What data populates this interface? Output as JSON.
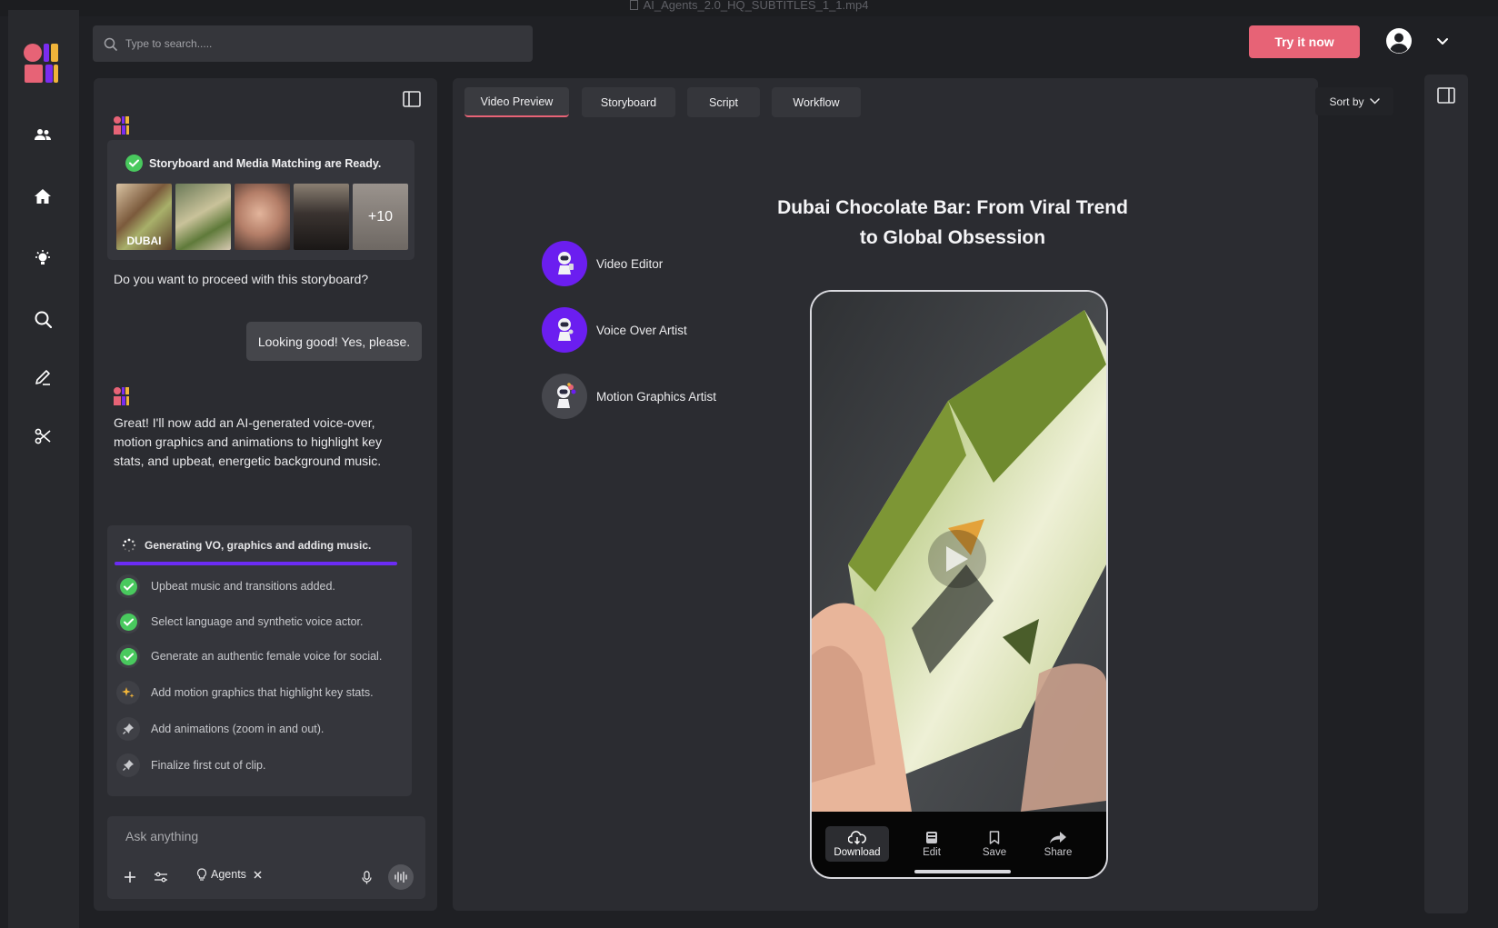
{
  "window": {
    "title": "AI_Agents_2.0_HQ_SUBTITLES_1_1.mp4"
  },
  "header": {
    "search_placeholder": "Type to search.....",
    "try_button": "Try it now"
  },
  "colors": {
    "accent": "#e76376",
    "progress": "#6b2cf5",
    "success": "#49c95e",
    "agent_purple": "#6b1ef0"
  },
  "rail": {
    "icons": [
      "people-icon",
      "home-icon",
      "lightbulb-icon",
      "search-icon",
      "edit-icon",
      "scissors-icon"
    ]
  },
  "chat": {
    "ready_title": "Storyboard and Media Matching are Ready.",
    "thumb_caption": "DUBAI",
    "more_count": "+10",
    "question": "Do you want to proceed with this storyboard?",
    "user_reply": "Looking good! Yes, please.",
    "bot_reply": "Great! I'll now add an AI-generated voice-over, motion graphics and animations to highlight key stats, and upbeat, energetic background music.",
    "generating_title": "Generating VO, graphics and adding music.",
    "steps": [
      {
        "label": "Upbeat music and transitions added.",
        "status": "done"
      },
      {
        "label": "Select language and synthetic voice actor.",
        "status": "done"
      },
      {
        "label": "Generate an authentic female voice for social.",
        "status": "done"
      },
      {
        "label": "Add motion graphics that highlight key stats.",
        "status": "in-progress"
      },
      {
        "label": "Add animations (zoom in and out).",
        "status": "pending"
      },
      {
        "label": "Finalize first cut of clip.",
        "status": "pending"
      }
    ],
    "composer_placeholder": "Ask anything",
    "agents_chip": "Agents"
  },
  "main": {
    "tabs": [
      {
        "label": "Video Preview",
        "active": true
      },
      {
        "label": "Storyboard",
        "active": false
      },
      {
        "label": "Script",
        "active": false
      },
      {
        "label": "Workflow",
        "active": false
      }
    ],
    "sort_label": "Sort by",
    "video_title_line1": "Dubai Chocolate Bar: From Viral Trend",
    "video_title_line2": "to Global Obsession",
    "agents": [
      {
        "label": "Video Editor"
      },
      {
        "label": "Voice Over Artist"
      },
      {
        "label": "Motion Graphics Artist"
      }
    ],
    "phone_actions": [
      {
        "label": "Download",
        "icon": "cloud-download-icon",
        "active": true
      },
      {
        "label": "Edit",
        "icon": "edit-icon",
        "active": false
      },
      {
        "label": "Save",
        "icon": "bookmark-icon",
        "active": false
      },
      {
        "label": "Share",
        "icon": "share-icon",
        "active": false
      }
    ]
  }
}
